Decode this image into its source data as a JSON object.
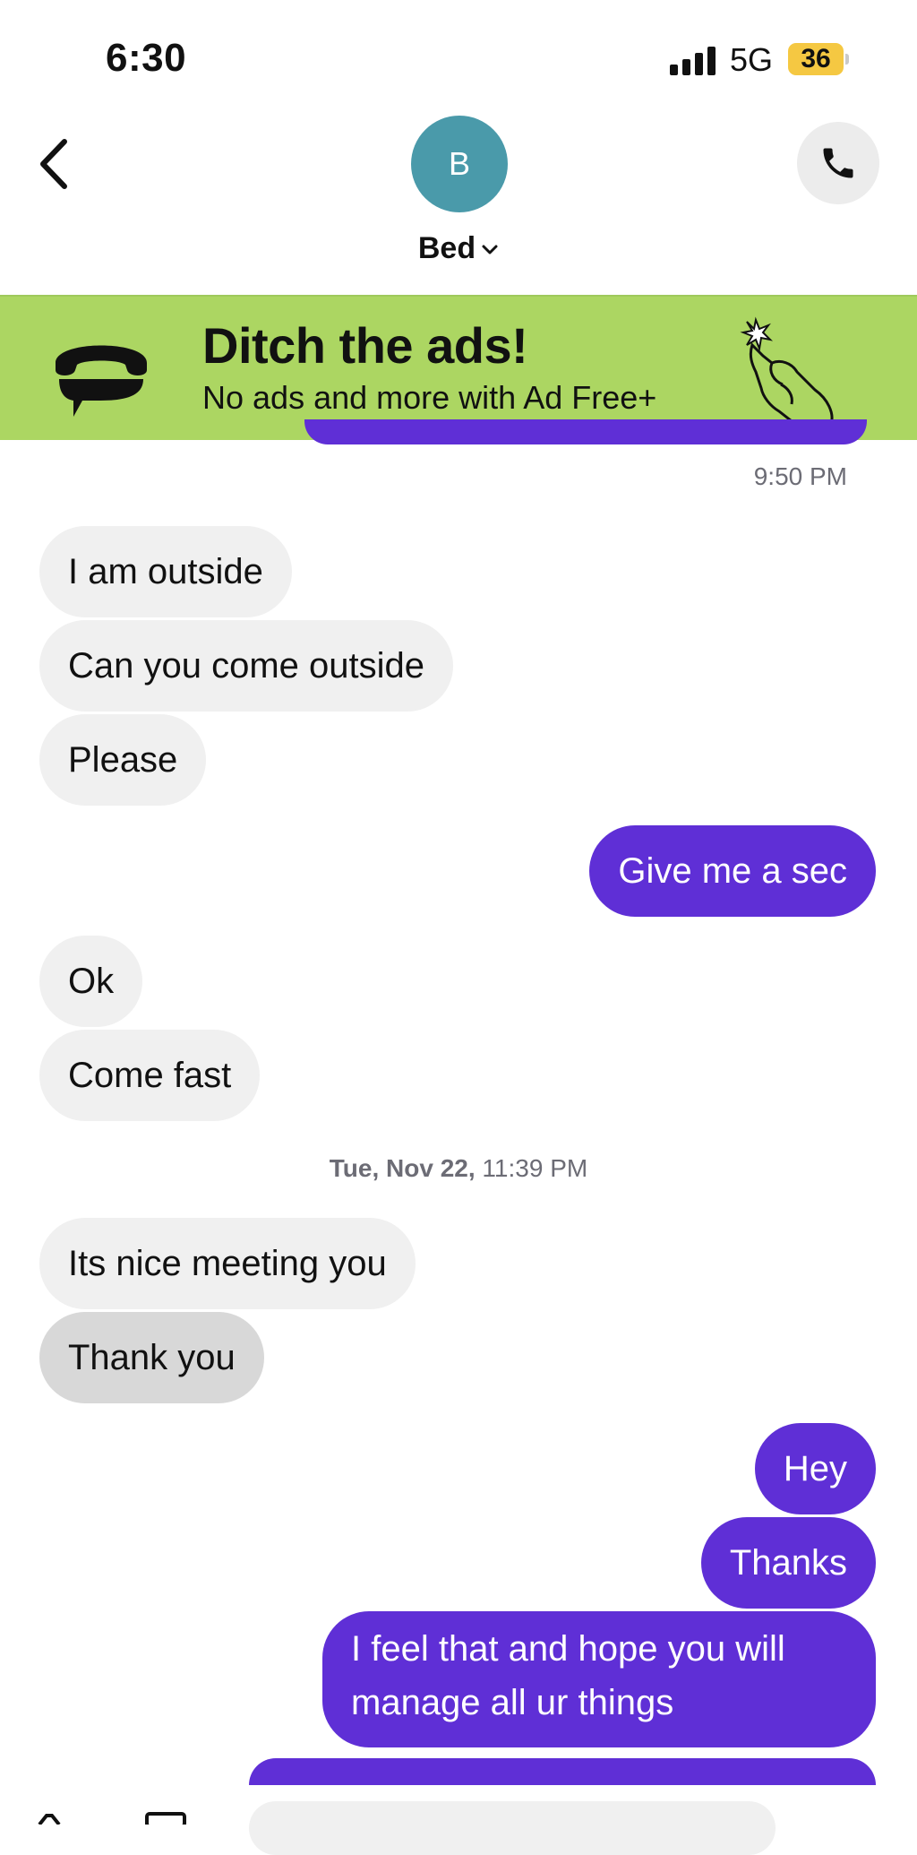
{
  "status_bar": {
    "time": "6:30",
    "network": "5G",
    "battery": "36"
  },
  "header": {
    "avatar_initial": "B",
    "contact_name": "Bed",
    "back_icon": "chevron-left-icon",
    "call_icon": "phone-icon",
    "avatar_color": "#4a9aaa"
  },
  "ad": {
    "title": "Ditch the ads!",
    "subtitle": "No ads and more with Ad Free+",
    "background": "#acd662"
  },
  "conversation": {
    "timestamp_1": "9:50 PM",
    "group_1": [
      {
        "text": "I am outside"
      },
      {
        "text": "Can you come outside"
      },
      {
        "text": "Please"
      }
    ],
    "sent_1": "Give me a sec",
    "group_2": [
      {
        "text": "Ok"
      },
      {
        "text": "Come fast"
      }
    ],
    "timestamp_2_date": "Tue, Nov 22,",
    "timestamp_2_time": "11:39 PM",
    "group_3": [
      {
        "text": "Its nice meeting you"
      },
      {
        "text": "Thank you"
      }
    ],
    "sent_2": [
      {
        "text": "Hey"
      },
      {
        "text": "Thanks"
      },
      {
        "text": "I feel that and hope you will manage all ur things"
      }
    ]
  },
  "colors": {
    "sent_bubble": "#5f2fd6",
    "received_bubble": "#f0f0f0"
  }
}
